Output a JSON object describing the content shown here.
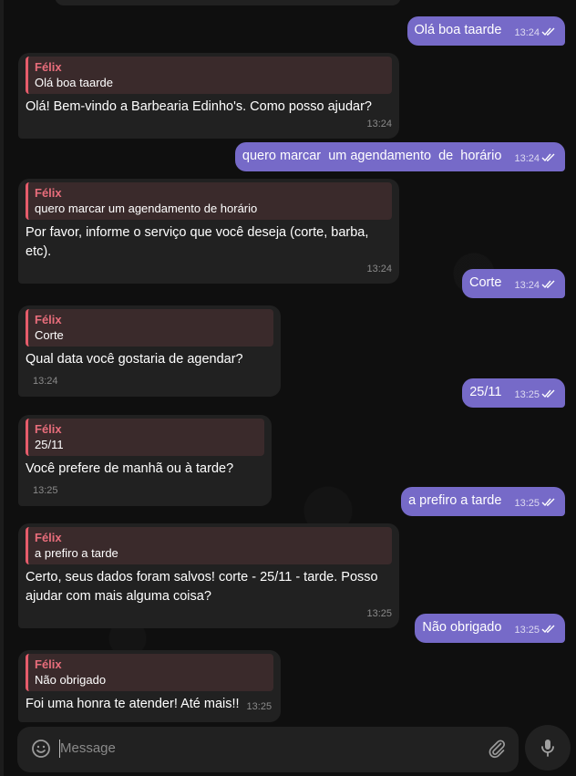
{
  "chat": {
    "messages": [
      {
        "dir": "out",
        "text": "Olá boa taarde",
        "time": "13:24"
      },
      {
        "dir": "in",
        "reply_author": "Félix",
        "reply_text": "Olá boa taarde",
        "text": "Olá! Bem-vindo a Barbearia Edinho's. Como posso ajudar?",
        "time": "13:24"
      },
      {
        "dir": "out",
        "text": "quero marcar  um agendamento  de  horário",
        "time": "13:24"
      },
      {
        "dir": "in",
        "reply_author": "Félix",
        "reply_text": "quero marcar um agendamento de horário",
        "text": "Por favor, informe o serviço que você deseja (corte, barba, etc).",
        "time": "13:24"
      },
      {
        "dir": "out",
        "text": "Corte",
        "time": "13:24"
      },
      {
        "dir": "in",
        "reply_author": "Félix",
        "reply_text": "Corte",
        "text": "Qual data você gostaria de agendar?",
        "time": "13:24"
      },
      {
        "dir": "out",
        "text": "25/11",
        "time": "13:25"
      },
      {
        "dir": "in",
        "reply_author": "Félix",
        "reply_text": "25/11",
        "text": "Você prefere de manhã ou à tarde?",
        "time": "13:25"
      },
      {
        "dir": "out",
        "text": "a prefiro a tarde",
        "time": "13:25"
      },
      {
        "dir": "in",
        "reply_author": "Félix",
        "reply_text": "a prefiro a tarde",
        "text": "Certo, seus dados foram salvos! corte - 25/11 - tarde. Posso ajudar com mais alguma coisa?",
        "time": "13:25"
      },
      {
        "dir": "out",
        "text": "Não obrigado",
        "time": "13:25"
      },
      {
        "dir": "in",
        "reply_author": "Félix",
        "reply_text": "Não obrigado",
        "text": "Foi uma honra te atender! Até mais!!",
        "time": "13:25"
      }
    ]
  },
  "composer": {
    "placeholder": "Message",
    "emoji_icon": "smiley-icon",
    "attach_icon": "paperclip-icon",
    "mic_icon": "microphone-icon"
  },
  "colors": {
    "outgoing_bubble": "#766ac8",
    "incoming_bubble": "#212121",
    "reply_accent": "#e65c6b",
    "background": "#0f0f0f"
  }
}
